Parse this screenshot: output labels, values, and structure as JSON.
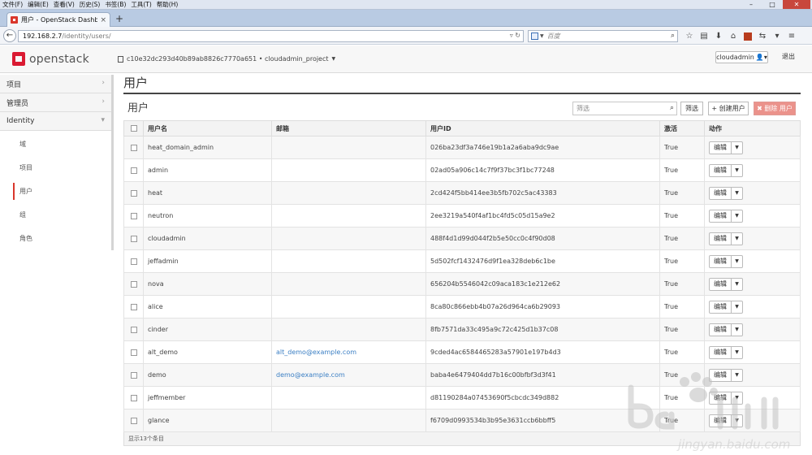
{
  "browser": {
    "menu": [
      "文件(F)",
      "编辑(E)",
      "查看(V)",
      "历史(S)",
      "书签(B)",
      "工具(T)",
      "帮助(H)"
    ],
    "tab_title": "用户 - OpenStack Dashb...",
    "url_host": "192.168.2.7",
    "url_path": "/identity/users/",
    "search_placeholder": "百度"
  },
  "header": {
    "logo_text": "openstack",
    "project": "c10e32dc293d40b89ab8826c7770a651 • cloudadmin_project",
    "user": "cloudadmin",
    "logout": "退出"
  },
  "sidebar": {
    "categories": [
      "项目",
      "管理员",
      "Identity"
    ],
    "identity_items": [
      "域",
      "项目",
      "用户",
      "组",
      "角色"
    ]
  },
  "main": {
    "page_title": "用户",
    "section_title": "用户",
    "filter_placeholder": "筛选",
    "filter_button": "筛选",
    "create_button": "+ 创建用户",
    "delete_button": "✖ 删除 用户",
    "columns": [
      "用户名",
      "邮箱",
      "用户ID",
      "激活",
      "动作"
    ],
    "action_label": "编辑",
    "rows": [
      {
        "name": "heat_domain_admin",
        "email": "",
        "id": "026ba23df3a746e19b1a2a6aba9dc9ae",
        "enabled": "True"
      },
      {
        "name": "admin",
        "email": "",
        "id": "02ad05a906c14c7f9f37bc3f1bc77248",
        "enabled": "True"
      },
      {
        "name": "heat",
        "email": "",
        "id": "2cd424f5bb414ee3b5fb702c5ac43383",
        "enabled": "True"
      },
      {
        "name": "neutron",
        "email": "",
        "id": "2ee3219a540f4af1bc4fd5c05d15a9e2",
        "enabled": "True"
      },
      {
        "name": "cloudadmin",
        "email": "",
        "id": "488f4d1d99d044f2b5e50cc0c4f90d08",
        "enabled": "True"
      },
      {
        "name": "jeffadmin",
        "email": "",
        "id": "5d502fcf1432476d9f1ea328deb6c1be",
        "enabled": "True"
      },
      {
        "name": "nova",
        "email": "",
        "id": "656204b5546042c09aca183c1e212e62",
        "enabled": "True"
      },
      {
        "name": "alice",
        "email": "",
        "id": "8ca80c866ebb4b07a26d964ca6b29093",
        "enabled": "True"
      },
      {
        "name": "cinder",
        "email": "",
        "id": "8fb7571da33c495a9c72c425d1b37c08",
        "enabled": "True"
      },
      {
        "name": "alt_demo",
        "email": "alt_demo@example.com",
        "id": "9cded4ac6584465283a57901e197b4d3",
        "enabled": "True"
      },
      {
        "name": "demo",
        "email": "demo@example.com",
        "id": "baba4e6479404dd7b16c00bfbf3d3f41",
        "enabled": "True"
      },
      {
        "name": "jeffmember",
        "email": "",
        "id": "d81190284a07453690f5cbcdc349d882",
        "enabled": "True"
      },
      {
        "name": "glance",
        "email": "",
        "id": "f6709d0993534b3b95e3631ccb6bbff5",
        "enabled": "True"
      }
    ],
    "footer": "显示13个条目"
  }
}
